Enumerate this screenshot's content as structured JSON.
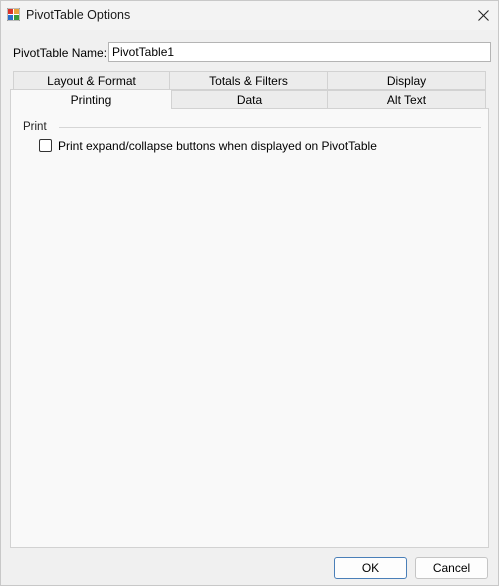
{
  "window": {
    "title": "PivotTable Options",
    "icon": "pivottable-app-icon",
    "close_icon": "close-icon"
  },
  "name_field": {
    "label": "PivotTable Name:",
    "value": "PivotTable1"
  },
  "tabs": {
    "row_back": [
      {
        "label": "Layout & Format"
      },
      {
        "label": "Totals & Filters"
      },
      {
        "label": "Display"
      }
    ],
    "row_front": [
      {
        "label": "Printing",
        "active": true
      },
      {
        "label": "Data"
      },
      {
        "label": "Alt Text"
      }
    ]
  },
  "printing": {
    "group_label": "Print",
    "checkbox_label": "Print expand/collapse buttons when displayed on PivotTable",
    "checked": false
  },
  "buttons": {
    "ok": "OK",
    "cancel": "Cancel"
  },
  "colors": {
    "default_button_border": "#4a7fb8",
    "panel_background": "#f9f9f9",
    "window_background": "#f0f0f0"
  }
}
